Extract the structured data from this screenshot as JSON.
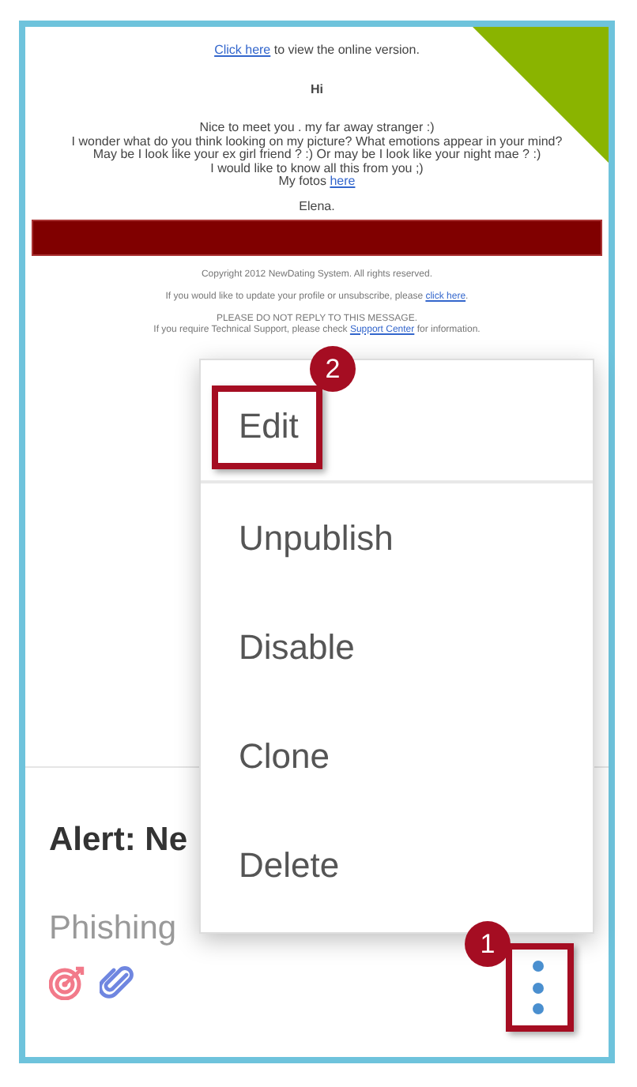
{
  "email_preview": {
    "online_line": {
      "link": "Click here",
      "after": " to view the online version."
    },
    "greeting": "Hi",
    "message_lines": [
      "Nice to meet you . my far away stranger :)",
      "I wonder what do you think looking on my picture? What emotions appear in your mind?",
      "May be I look like your ex girl friend ? :) Or may be I look like your night mae ? :)",
      "I would like to know all this from you ;)"
    ],
    "photos_line": {
      "before": "My fotos ",
      "link": "here"
    },
    "signature": "Elena.",
    "copyright": "Copyright 2012 NewDating System. All rights reserved.",
    "unsubscribe_line": {
      "before": "If you would like to update your profile or unsubscribe, please ",
      "link": "click here",
      "after": "."
    },
    "notice": "PLEASE DO NOT REPLY TO THIS MESSAGE.",
    "support_line": {
      "before": "If you require Technical Support, please check ",
      "link": "Support Center",
      "after": " for information."
    }
  },
  "card": {
    "title": "Alert: Ne",
    "category": "Phishing"
  },
  "menu": {
    "items": [
      {
        "label": "Edit",
        "highlighted": true
      },
      {
        "label": "Unpublish",
        "highlighted": false
      },
      {
        "label": "Disable",
        "highlighted": false
      },
      {
        "label": "Clone",
        "highlighted": false
      },
      {
        "label": "Delete",
        "highlighted": false
      }
    ]
  },
  "annotations": [
    {
      "label": "1"
    },
    {
      "label": "2"
    }
  ]
}
